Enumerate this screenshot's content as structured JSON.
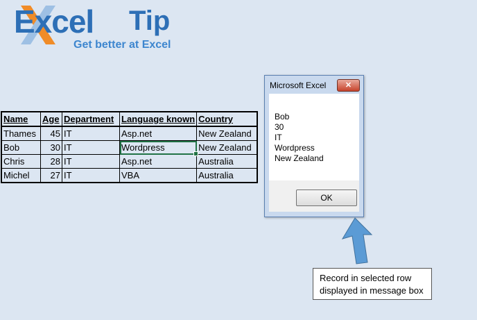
{
  "logo": {
    "word": "Excel",
    "tip": "Tip",
    "tagline": "Get better at Excel"
  },
  "table": {
    "headers": [
      "Name",
      "Age",
      "Department",
      "Language known",
      "Country"
    ],
    "rows": [
      [
        "Thames",
        "45",
        "IT",
        "Asp.net",
        "New Zealand"
      ],
      [
        "Bob",
        "30",
        "IT",
        "Wordpress",
        "New Zealand"
      ],
      [
        "Chris",
        "28",
        "IT",
        "Asp.net",
        "Australia"
      ],
      [
        "Michel",
        "27",
        "IT",
        "VBA",
        "Australia"
      ]
    ]
  },
  "messagebox": {
    "title": "Microsoft Excel",
    "close_label": "✕",
    "lines": [
      "Bob",
      "30",
      "IT",
      "Wordpress",
      "New Zealand"
    ],
    "ok_label": "OK"
  },
  "callout": {
    "line1": "Record in selected row",
    "line2": "displayed in message box"
  },
  "colors": {
    "background": "#dce6f2",
    "logo_blue": "#2d6fb6",
    "logo_orange": "#f08c28",
    "selection_green": "#217346",
    "arrow_blue": "#5b9bd5"
  }
}
